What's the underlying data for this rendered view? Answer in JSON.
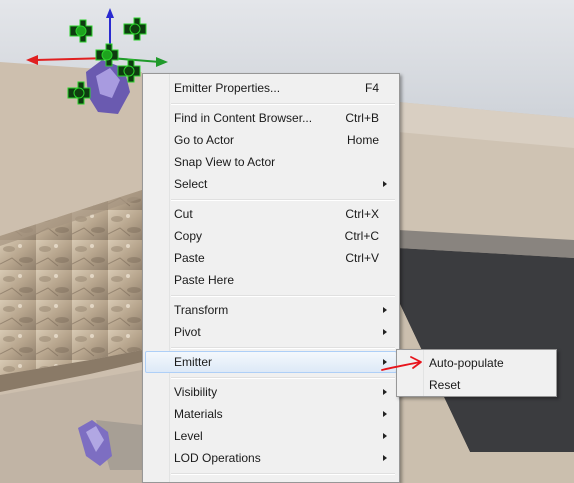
{
  "context_menu": {
    "groups": [
      [
        {
          "label": "Emitter Properties...",
          "shortcut": "F4",
          "submenu": false
        }
      ],
      [
        {
          "label": "Find in Content Browser...",
          "shortcut": "Ctrl+B",
          "submenu": false
        },
        {
          "label": "Go to Actor",
          "shortcut": "Home",
          "submenu": false
        },
        {
          "label": "Snap View to Actor",
          "shortcut": "",
          "submenu": false
        },
        {
          "label": "Select",
          "shortcut": "",
          "submenu": true
        }
      ],
      [
        {
          "label": "Cut",
          "shortcut": "Ctrl+X",
          "submenu": false
        },
        {
          "label": "Copy",
          "shortcut": "Ctrl+C",
          "submenu": false
        },
        {
          "label": "Paste",
          "shortcut": "Ctrl+V",
          "submenu": false
        },
        {
          "label": "Paste Here",
          "shortcut": "",
          "submenu": false
        }
      ],
      [
        {
          "label": "Transform",
          "shortcut": "",
          "submenu": true
        },
        {
          "label": "Pivot",
          "shortcut": "",
          "submenu": true
        }
      ],
      [
        {
          "label": "Emitter",
          "shortcut": "",
          "submenu": true,
          "highlighted": true
        }
      ],
      [
        {
          "label": "Visibility",
          "shortcut": "",
          "submenu": true
        },
        {
          "label": "Materials",
          "shortcut": "",
          "submenu": true
        },
        {
          "label": "Level",
          "shortcut": "",
          "submenu": true
        },
        {
          "label": "LOD Operations",
          "shortcut": "",
          "submenu": true
        }
      ]
    ]
  },
  "submenu": {
    "items": [
      {
        "label": "Auto-populate"
      },
      {
        "label": "Reset"
      }
    ]
  },
  "annotation": {
    "color": "#e8141c",
    "icon": "red-arrow"
  },
  "colors": {
    "sky": "#9fa8b5",
    "ground": "#cdc1b1",
    "dark_slab": "#3d3e40",
    "gizmo_green": "#1f9a2a",
    "gizmo_red": "#e02020",
    "gizmo_blue": "#2a2ad0",
    "highlight_border": "#aecff7"
  }
}
